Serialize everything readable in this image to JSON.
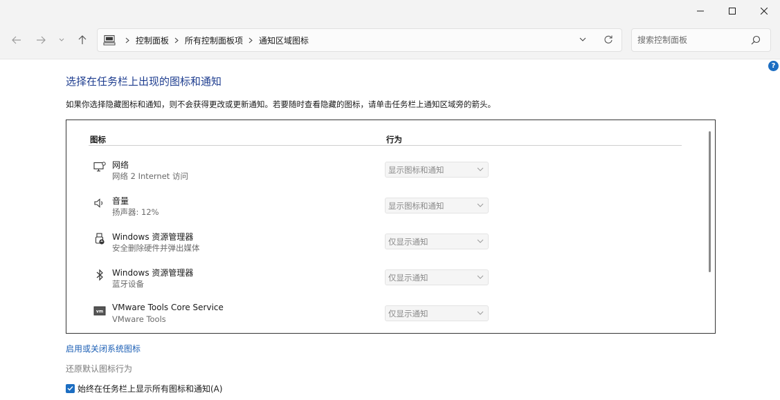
{
  "window": {
    "controls": {
      "minimize": "minimize-icon",
      "maximize": "maximize-icon",
      "close": "close-icon"
    }
  },
  "nav": {
    "breadcrumbs": [
      "控制面板",
      "所有控制面板项",
      "通知区域图标"
    ],
    "search_placeholder": "搜索控制面板"
  },
  "help_label": "?",
  "content": {
    "title": "选择在任务栏上出现的图标和通知",
    "description": "如果你选择隐藏图标和通知，则不会获得更改或更新通知。若要随时查看隐藏的图标，请单击任务栏上通知区域旁的箭头。",
    "table": {
      "col_icon": "图标",
      "col_behavior": "行为",
      "rows": [
        {
          "icon": "network-icon",
          "name": "网络",
          "sub": "网络 2 Internet 访问",
          "behavior": "显示图标和通知"
        },
        {
          "icon": "volume-icon",
          "name": "音量",
          "sub": "扬声器: 12%",
          "behavior": "显示图标和通知"
        },
        {
          "icon": "usb-eject-icon",
          "name": "Windows 资源管理器",
          "sub": "安全删除硬件并弹出媒体",
          "behavior": "仅显示通知"
        },
        {
          "icon": "bluetooth-icon",
          "name": "Windows 资源管理器",
          "sub": "蓝牙设备",
          "behavior": "仅显示通知"
        },
        {
          "icon": "vmware-icon",
          "name": "VMware Tools Core Service",
          "sub": "VMware Tools",
          "behavior": "仅显示通知"
        }
      ]
    },
    "link_system_icons": "启用或关闭系统图标",
    "link_restore": "还原默认图标行为",
    "checkbox_label": "始终在任务栏上显示所有图标和通知(A)",
    "checkbox_checked": true
  },
  "colors": {
    "accent": "#1c6ec2",
    "title": "#1e3d8f",
    "link": "#1c5fb5"
  }
}
